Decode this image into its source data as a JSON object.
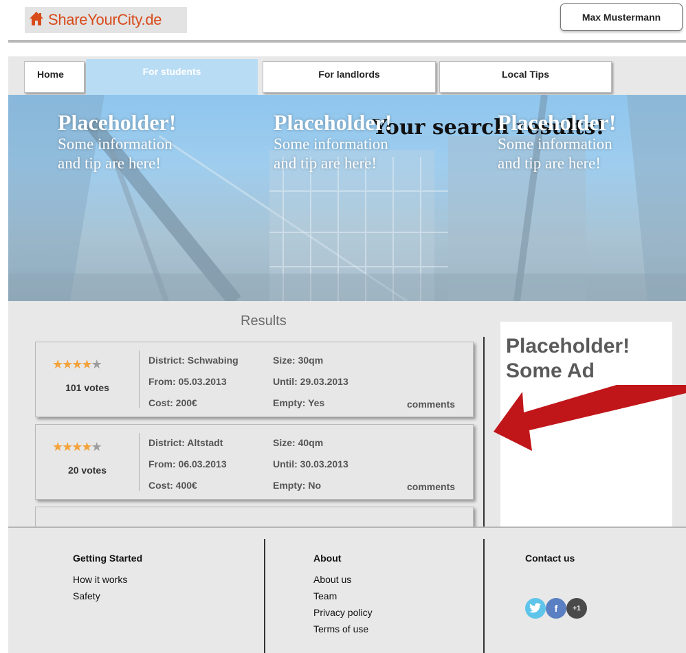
{
  "header": {
    "logo_icon": "house-icon",
    "logo_text": "ShareYourCity.de",
    "user_name": "Max Mustermann"
  },
  "tabs": [
    {
      "label": "Home"
    },
    {
      "label": "For students"
    },
    {
      "label": "For landlords"
    },
    {
      "label": "Local Tips"
    }
  ],
  "hero": {
    "title": "Your search results!",
    "placeholders": [
      {
        "head": "Placeholder!",
        "line1": "Some information",
        "line2": "and tip are here!"
      },
      {
        "head": "Placeholder!",
        "line1": "Some information",
        "line2": "and tip are here!"
      },
      {
        "head": "Placeholder!",
        "line1": "Some information",
        "line2": "and tip are here!"
      }
    ]
  },
  "results": {
    "title": "Results",
    "items": [
      {
        "rating_stars": 4,
        "votes": "101 votes",
        "district": "District: Schwabing",
        "from": "From: 05.03.2013",
        "cost": "Cost: 200€",
        "size": "Size: 30qm",
        "until": "Until: 29.03.2013",
        "empty": "Empty: Yes",
        "comments": "comments"
      },
      {
        "rating_stars": 4,
        "votes": "20 votes",
        "district": "District: Altstadt",
        "from": "From: 06.03.2013",
        "cost": "Cost: 400€",
        "size": "Size: 40qm",
        "until": "Until: 30.03.2013",
        "empty": "Empty: No",
        "comments": "comments"
      }
    ]
  },
  "ad": {
    "line1": "Placeholder!",
    "line2": "Some Ad"
  },
  "footer": {
    "getting_started": {
      "head": "Getting Started",
      "links": [
        "How it works",
        "Safety"
      ]
    },
    "about": {
      "head": "About",
      "links": [
        "About us",
        "Team",
        "Privacy policy",
        "Terms of use"
      ]
    },
    "contact": {
      "head": "Contact us",
      "icons": [
        "twitter-icon",
        "facebook-icon",
        "google-plus-icon"
      ],
      "gplus_label": "+1"
    }
  },
  "colors": {
    "brand": "#d84a1a",
    "active_tab": "#b9dcf5",
    "star": "#f4a23a",
    "arrow": "#c0161a"
  }
}
